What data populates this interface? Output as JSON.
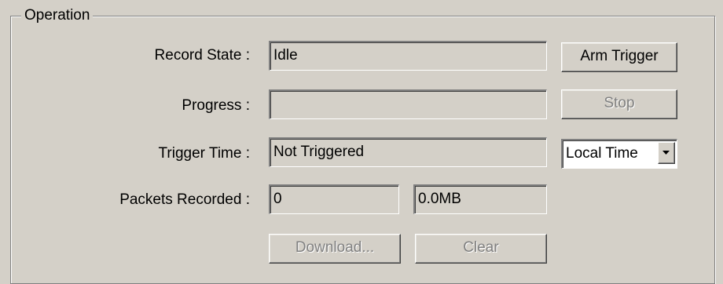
{
  "group": {
    "title": "Operation"
  },
  "record_state": {
    "label": "Record State :",
    "value": "Idle",
    "button": "Arm Trigger"
  },
  "progress": {
    "label": "Progress :",
    "value": "",
    "button": "Stop",
    "button_enabled": false
  },
  "trigger_time": {
    "label": "Trigger Time :",
    "value": "Not Triggered",
    "select_value": "Local Time",
    "select_icon": "chevron-down-icon"
  },
  "packets": {
    "label": "Packets Recorded :",
    "count": "0",
    "size": "0.0MB"
  },
  "actions": {
    "download": "Download...",
    "download_enabled": false,
    "clear": "Clear",
    "clear_enabled": false
  },
  "colors": {
    "face": "#d4d0c8",
    "disabled_text": "#808080",
    "field_white": "#ffffff"
  }
}
